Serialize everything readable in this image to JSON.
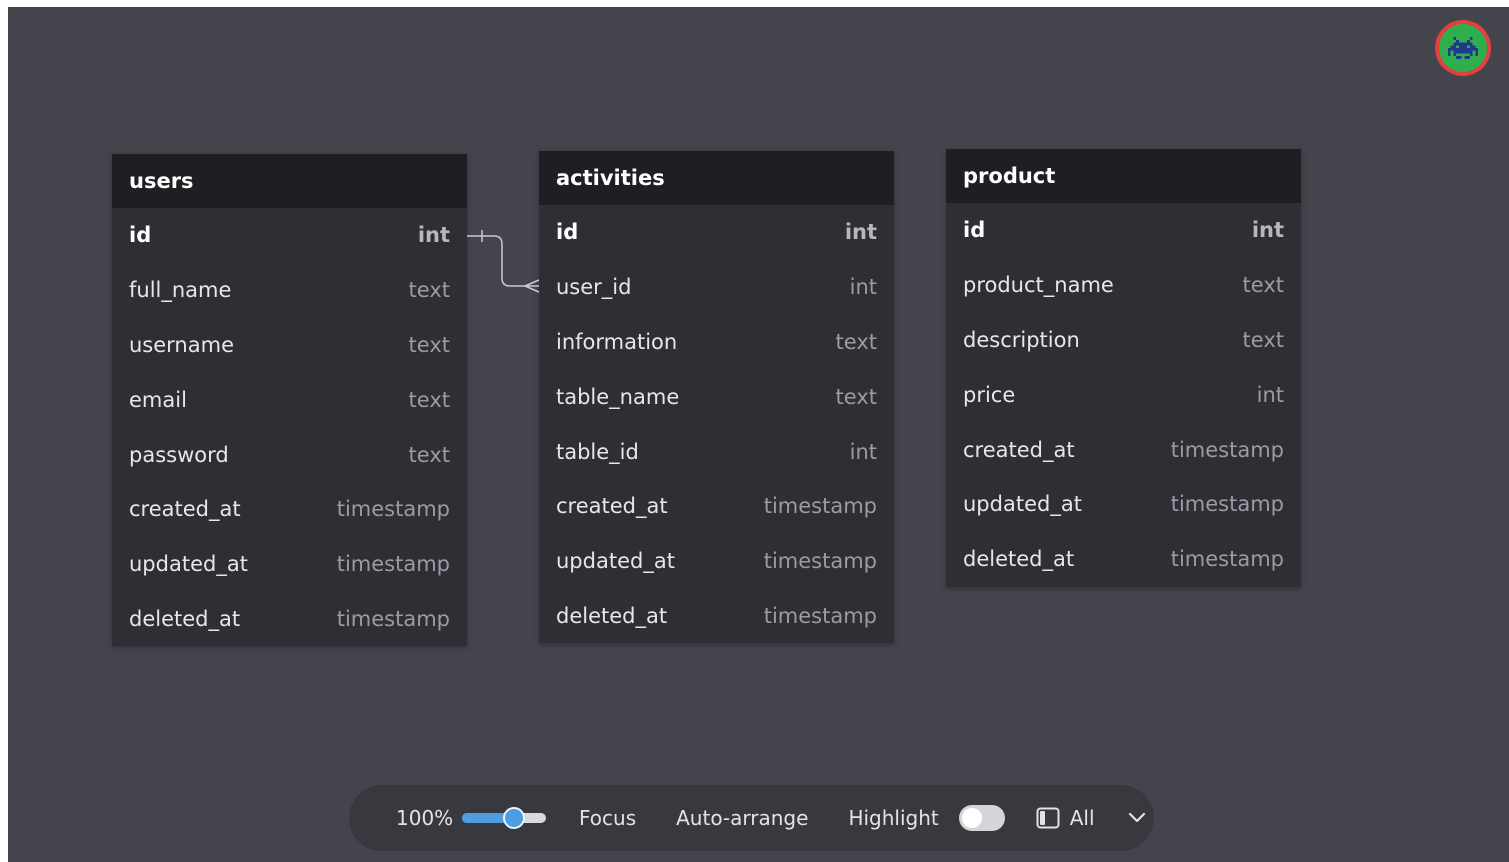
{
  "tables": [
    {
      "name": "users",
      "columns": [
        {
          "name": "id",
          "type": "int",
          "pk": true
        },
        {
          "name": "full_name",
          "type": "text"
        },
        {
          "name": "username",
          "type": "text"
        },
        {
          "name": "email",
          "type": "text"
        },
        {
          "name": "password",
          "type": "text"
        },
        {
          "name": "created_at",
          "type": "timestamp"
        },
        {
          "name": "updated_at",
          "type": "timestamp"
        },
        {
          "name": "deleted_at",
          "type": "timestamp"
        }
      ]
    },
    {
      "name": "activities",
      "columns": [
        {
          "name": "id",
          "type": "int",
          "pk": true
        },
        {
          "name": "user_id",
          "type": "int"
        },
        {
          "name": "information",
          "type": "text"
        },
        {
          "name": "table_name",
          "type": "text"
        },
        {
          "name": "table_id",
          "type": "int"
        },
        {
          "name": "created_at",
          "type": "timestamp"
        },
        {
          "name": "updated_at",
          "type": "timestamp"
        },
        {
          "name": "deleted_at",
          "type": "timestamp"
        }
      ]
    },
    {
      "name": "product",
      "columns": [
        {
          "name": "id",
          "type": "int",
          "pk": true
        },
        {
          "name": "product_name",
          "type": "text"
        },
        {
          "name": "description",
          "type": "text"
        },
        {
          "name": "price",
          "type": "int"
        },
        {
          "name": "created_at",
          "type": "timestamp"
        },
        {
          "name": "updated_at",
          "type": "timestamp"
        },
        {
          "name": "deleted_at",
          "type": "timestamp"
        }
      ]
    }
  ],
  "toolbar": {
    "zoom_label": "100%",
    "zoom_fraction": 0.62,
    "focus_label": "Focus",
    "auto_arrange_label": "Auto-arrange",
    "highlight_label": "Highlight",
    "highlight_on": false,
    "view_filter_label": "All",
    "view_filter_icon": "panel-layout-icon",
    "expand_icon": "chevron-down-icon"
  },
  "avatar": {
    "icon": "space-invader-icon",
    "ring_color": "#e53e3e",
    "fill_color": "#2fae4e"
  },
  "theme": {
    "canvas": "#44444d",
    "table_bg": "#2e2e35",
    "header_bg": "#1f1f23",
    "accent": "#4d9de0"
  }
}
